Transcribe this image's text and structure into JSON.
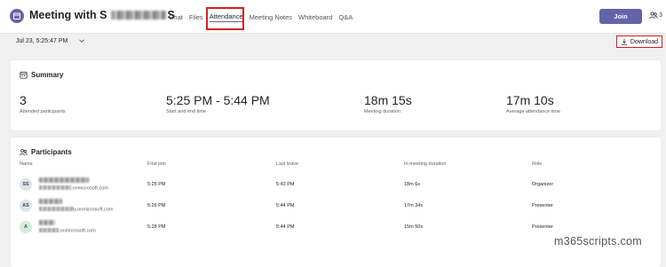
{
  "header": {
    "title_prefix": "Meeting with S",
    "title_suffix": "S",
    "tabs": [
      {
        "label": "Chat",
        "active": false
      },
      {
        "label": "Files",
        "active": false
      },
      {
        "label": "Attendance",
        "active": true
      },
      {
        "label": "Meeting Notes",
        "active": false
      },
      {
        "label": "Whiteboard",
        "active": false
      },
      {
        "label": "Q&A",
        "active": false
      }
    ],
    "join_label": "Join",
    "people_count": "3"
  },
  "session": {
    "selected": "Jul 23, 5:25:47 PM",
    "download_label": "Download"
  },
  "summary": {
    "heading": "Summary",
    "stats": [
      {
        "value": "3",
        "label": "Attended participants"
      },
      {
        "value": "5:25 PM - 5:44 PM",
        "label": "Start and end time"
      },
      {
        "value": "18m 15s",
        "label": "Meeting duration"
      },
      {
        "value": "17m 10s",
        "label": "Average attendance time"
      }
    ]
  },
  "participants": {
    "heading": "Participants",
    "columns": [
      "Name",
      "First join",
      "Last leave",
      "In-meeting duration",
      "Role"
    ],
    "rows": [
      {
        "initials": "SS",
        "email_suffix": ".onmicrosoft.com",
        "first_join": "5:25 PM",
        "last_leave": "5:43 PM",
        "duration": "18m 6s",
        "role": "Organizer",
        "avatar_bg": "#dfe3ea",
        "avatar_fg": "#444b5a"
      },
      {
        "initials": "AS",
        "email_suffix": "ly.onmicrosoft.com",
        "first_join": "5:26 PM",
        "last_leave": "5:44 PM",
        "duration": "17m 34s",
        "role": "Presenter",
        "avatar_bg": "#dde4ee",
        "avatar_fg": "#3d4a60"
      },
      {
        "initials": "A",
        "email_suffix": ".onmicrosoft.com",
        "first_join": "5:28 PM",
        "last_leave": "5:44 PM",
        "duration": "15m 50s",
        "role": "Presenter",
        "avatar_bg": "#d6ecd9",
        "avatar_fg": "#2b6a36"
      }
    ]
  },
  "watermark": "m365scripts.com",
  "colors": {
    "accent": "#6264a7",
    "highlight": "#d42020",
    "background": "#f0f0f0"
  }
}
